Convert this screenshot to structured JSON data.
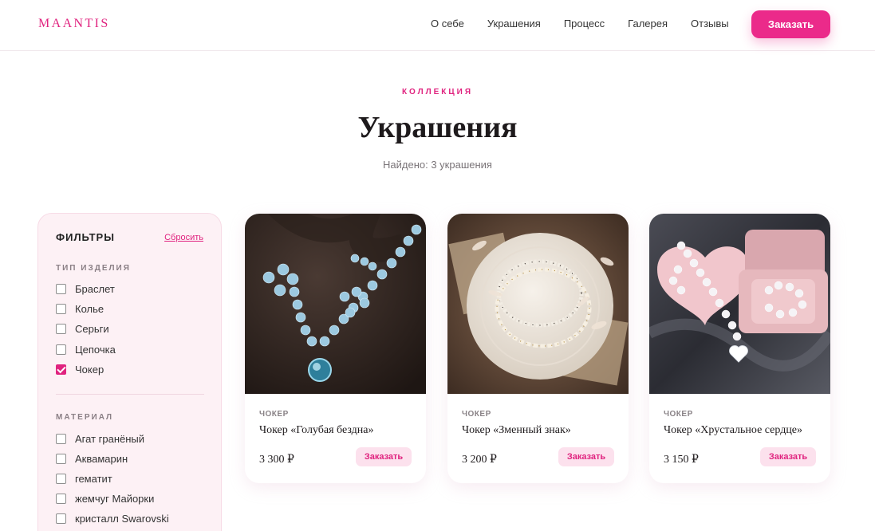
{
  "brand": {
    "logo": "MAANTIS",
    "accent": "#e0237f"
  },
  "nav": {
    "items": [
      "О себе",
      "Украшения",
      "Процесс",
      "Галерея",
      "Отзывы"
    ],
    "order_label": "Заказать"
  },
  "hero": {
    "eyebrow": "КОЛЛЕКЦИЯ",
    "title": "Украшения",
    "found": "Найдено: 3 украшения"
  },
  "filters": {
    "title": "ФИЛЬТРЫ",
    "reset_label": "Сбросить",
    "type_group": {
      "title": "ТИП ИЗДЕЛИЯ",
      "options": [
        {
          "label": "Браслет",
          "checked": false
        },
        {
          "label": "Колье",
          "checked": false
        },
        {
          "label": "Серьги",
          "checked": false
        },
        {
          "label": "Цепочка",
          "checked": false
        },
        {
          "label": "Чокер",
          "checked": true
        }
      ]
    },
    "material_group": {
      "title": "МАТЕРИАЛ",
      "options": [
        {
          "label": "Агат гранёный",
          "checked": false
        },
        {
          "label": "Аквамарин",
          "checked": false
        },
        {
          "label": "гематит",
          "checked": false
        },
        {
          "label": "жемчуг Майорки",
          "checked": false
        },
        {
          "label": "кристалл Swarovski",
          "checked": false
        }
      ]
    }
  },
  "products": [
    {
      "type": "ЧОКЕР",
      "name": "Чокер «Голубая бездна»",
      "price": "3 300 ₽",
      "button": "Заказать"
    },
    {
      "type": "ЧОКЕР",
      "name": "Чокер «Зменный знак»",
      "price": "3 200 ₽",
      "button": "Заказать"
    },
    {
      "type": "ЧОКЕР",
      "name": "Чокер «Хрустальное сердце»",
      "price": "3 150 ₽",
      "button": "Заказать"
    }
  ]
}
